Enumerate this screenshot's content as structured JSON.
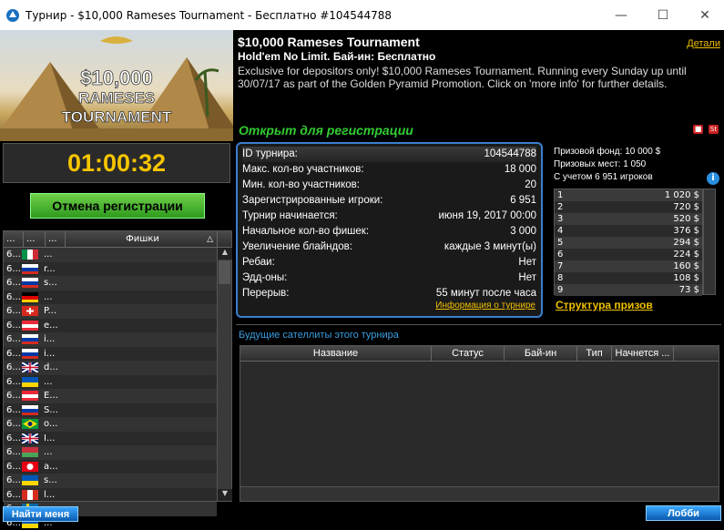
{
  "window": {
    "title": "Турнир - $10,000 Rameses Tournament - Бесплатно #104544788"
  },
  "banner": {
    "line1": "$10,000",
    "line2": "RAMESES",
    "line3": "TOURNAMENT"
  },
  "header": {
    "title": "$10,000 Rameses Tournament",
    "details_link": "Детали",
    "subtitle": "Hold'em No Limit. Бай-ин: Бесплатно",
    "description": "Exclusive for depositors only! $10,000 Rameses Tournament. Running every Sunday up until 30/07/17 as part of the Golden Pyramid Promotion. Click on 'more info' for further details.",
    "status": "Открыт для регистрации",
    "badge_lock": "🔒",
    "badge_st": "St"
  },
  "timer": "01:00:32",
  "cancel_button": "Отмена регистрации",
  "players": {
    "headers": [
      "...",
      "...",
      "...",
      "Фишки"
    ],
    "sort_icon": "△",
    "rows": [
      {
        "c1": "6...",
        "flag": "it",
        "name": "..."
      },
      {
        "c1": "6...",
        "flag": "ru",
        "name": "r..."
      },
      {
        "c1": "6...",
        "flag": "ru",
        "name": "s..."
      },
      {
        "c1": "6...",
        "flag": "de",
        "name": "..."
      },
      {
        "c1": "6...",
        "flag": "ch",
        "name": "P..."
      },
      {
        "c1": "6...",
        "flag": "at",
        "name": "e..."
      },
      {
        "c1": "6...",
        "flag": "ru",
        "name": "i..."
      },
      {
        "c1": "6...",
        "flag": "ru",
        "name": "i..."
      },
      {
        "c1": "6...",
        "flag": "gb",
        "name": "d..."
      },
      {
        "c1": "6...",
        "flag": "ua",
        "name": "..."
      },
      {
        "c1": "6...",
        "flag": "at",
        "name": "E..."
      },
      {
        "c1": "6...",
        "flag": "ru",
        "name": "S..."
      },
      {
        "c1": "6...",
        "flag": "br",
        "name": "o..."
      },
      {
        "c1": "6...",
        "flag": "gb",
        "name": "I..."
      },
      {
        "c1": "6...",
        "flag": "by",
        "name": "..."
      },
      {
        "c1": "6...",
        "flag": "tn",
        "name": "a..."
      },
      {
        "c1": "6...",
        "flag": "ua",
        "name": "s..."
      },
      {
        "c1": "6...",
        "flag": "ca",
        "name": "l..."
      },
      {
        "c1": "6...",
        "flag": "se",
        "name": "..."
      },
      {
        "c1": "6...",
        "flag": "ua",
        "name": "..."
      }
    ]
  },
  "info": [
    {
      "label": "ID турнира:",
      "value": "104544788"
    },
    {
      "label": "Макс. кол-во участников:",
      "value": "18 000"
    },
    {
      "label": "Мин. кол-во участников:",
      "value": "20"
    },
    {
      "label": "Зарегистрированные игроки:",
      "value": "6 951"
    },
    {
      "label": "Турнир начинается:",
      "value": "июня 19, 2017 00:00"
    },
    {
      "label": "Начальное кол-во фишек:",
      "value": "3 000"
    },
    {
      "label": "Увеличение блайндов:",
      "value": "каждые 3 минут(ы)"
    },
    {
      "label": "Ребаи:",
      "value": "Нет"
    },
    {
      "label": "Эдд-оны:",
      "value": "Нет"
    },
    {
      "label": "Перерыв:",
      "value": "55 минут после часа"
    }
  ],
  "info_link": "Информация о турнире",
  "prize": {
    "pool": "Призовой фонд: 10 000 $",
    "places": "Призовых мест: 1 050",
    "players": "С учетом 6 951 игроков",
    "info_icon": "i",
    "rows": [
      {
        "place": "1",
        "amount": "1 020 $"
      },
      {
        "place": "2",
        "amount": "720 $"
      },
      {
        "place": "3",
        "amount": "520 $"
      },
      {
        "place": "4",
        "amount": "376 $"
      },
      {
        "place": "5",
        "amount": "294 $"
      },
      {
        "place": "6",
        "amount": "224 $"
      },
      {
        "place": "7",
        "amount": "160 $"
      },
      {
        "place": "8",
        "amount": "108 $"
      },
      {
        "place": "9",
        "amount": "73 $"
      }
    ],
    "structure_link": "Структура призов"
  },
  "satellites": {
    "title": "Будущие сателлиты этого турнира",
    "headers": [
      "Название",
      "Статус",
      "Бай-ин",
      "Тип",
      "Начнется ..."
    ]
  },
  "buttons": {
    "find_me": "Найти меня",
    "lobby": "Лобби"
  }
}
